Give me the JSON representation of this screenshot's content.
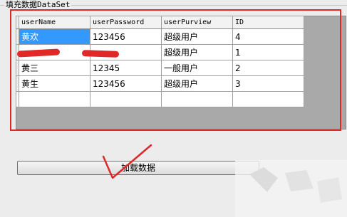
{
  "groupbox": {
    "title": "填充数据DataSet"
  },
  "grid": {
    "columns": [
      "userName",
      "userPassword",
      "userPurview",
      "ID"
    ],
    "rows": [
      {
        "userName": "黄欢",
        "userPassword": "123456",
        "userPurview": "超级用户",
        "ID": "4"
      },
      {
        "userName": "",
        "userPassword": "",
        "userPurview": "超级用户",
        "ID": "1"
      },
      {
        "userName": "黄三",
        "userPassword": "12345",
        "userPurview": "一般用户",
        "ID": "2"
      },
      {
        "userName": "黄生",
        "userPassword": "123456",
        "userPurview": "超级用户",
        "ID": "3"
      }
    ],
    "selected_cell": "rows.0.userName"
  },
  "load_button": {
    "label": "加载数据"
  },
  "colors": {
    "annotation_red": "#e02828",
    "selection_blue": "#3399ff"
  }
}
